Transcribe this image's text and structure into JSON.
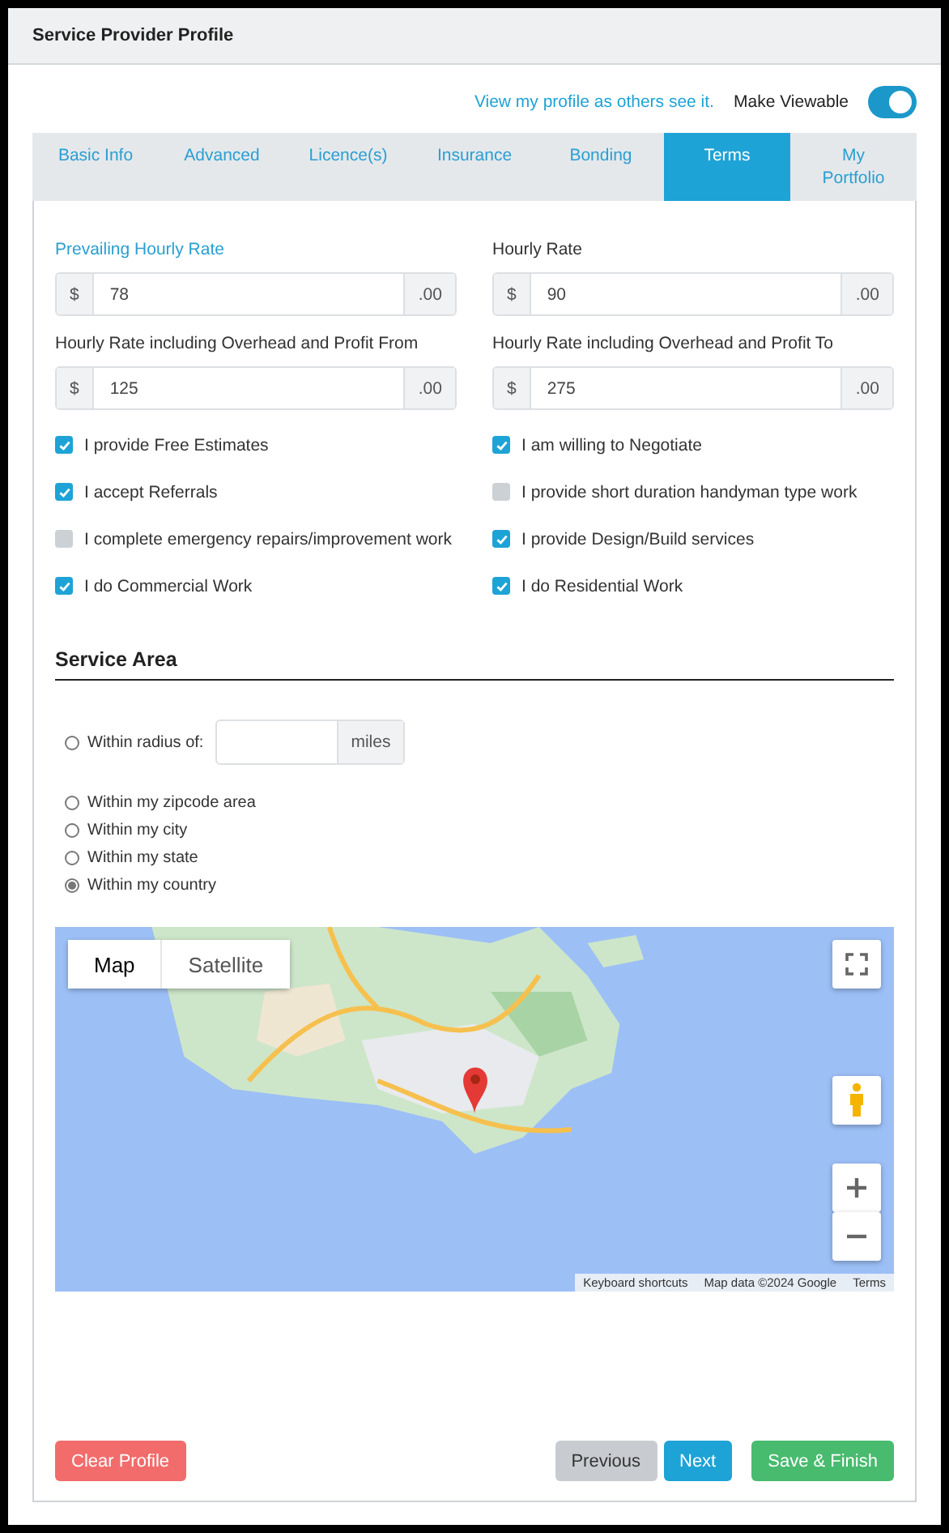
{
  "panel": {
    "title": "Service Provider Profile"
  },
  "top_bar": {
    "view_link": "View my profile as others see it.",
    "viewable_label": "Make Viewable",
    "viewable_on": true
  },
  "tabs": [
    {
      "label": "Basic Info",
      "selected": false
    },
    {
      "label": "Advanced",
      "selected": false
    },
    {
      "label": "Licence(s)",
      "selected": false
    },
    {
      "label": "Insurance",
      "selected": false
    },
    {
      "label": "Bonding",
      "selected": false
    },
    {
      "label": "Terms",
      "selected": true
    },
    {
      "label": "My Portfolio",
      "selected": false
    }
  ],
  "rates": [
    {
      "label": "Prevailing Hourly Rate",
      "highlight": true,
      "prefix": "$",
      "value": "78",
      "suffix": ".00"
    },
    {
      "label": "Hourly Rate",
      "highlight": false,
      "prefix": "$",
      "value": "90",
      "suffix": ".00"
    },
    {
      "label": "Hourly Rate including Overhead and Profit From",
      "highlight": false,
      "prefix": "$",
      "value": "125",
      "suffix": ".00"
    },
    {
      "label": "Hourly Rate including Overhead and Profit To",
      "highlight": false,
      "prefix": "$",
      "value": "275",
      "suffix": ".00"
    }
  ],
  "options": [
    {
      "label": "I provide Free Estimates",
      "checked": true
    },
    {
      "label": "I am willing to Negotiate",
      "checked": true
    },
    {
      "label": "I accept Referrals",
      "checked": true
    },
    {
      "label": "I provide short duration handyman type work",
      "checked": false
    },
    {
      "label": "I complete emergency repairs/improvement work",
      "checked": false
    },
    {
      "label": "I provide Design/Build services",
      "checked": true
    },
    {
      "label": "I do Commercial Work",
      "checked": true
    },
    {
      "label": "I do Residential Work",
      "checked": true
    }
  ],
  "service_area": {
    "title": "Service Area",
    "choices": [
      {
        "label": "Within radius of:",
        "selected": false,
        "kind": "radius",
        "unit": "miles"
      },
      {
        "label": "Within my zipcode area",
        "selected": false,
        "kind": "plain"
      },
      {
        "label": "Within my city",
        "selected": false,
        "kind": "plain"
      },
      {
        "label": "Within my state",
        "selected": false,
        "kind": "plain"
      },
      {
        "label": "Within my country",
        "selected": true,
        "kind": "plain"
      }
    ]
  },
  "map": {
    "kind": "picture",
    "map_types": [
      {
        "label": "Map",
        "selected": true
      },
      {
        "label": "Satellite",
        "selected": false
      }
    ],
    "attribution": [
      "Keyboard shortcuts",
      "Map data ©2024 Google",
      "Terms"
    ]
  },
  "footer": {
    "buttons": [
      {
        "label": "Clear Profile",
        "kind": "danger"
      },
      {
        "label": "Previous",
        "kind": "secondary"
      },
      {
        "label": "Next",
        "kind": "info"
      },
      {
        "label": "Save & Finish",
        "kind": "success"
      }
    ]
  }
}
